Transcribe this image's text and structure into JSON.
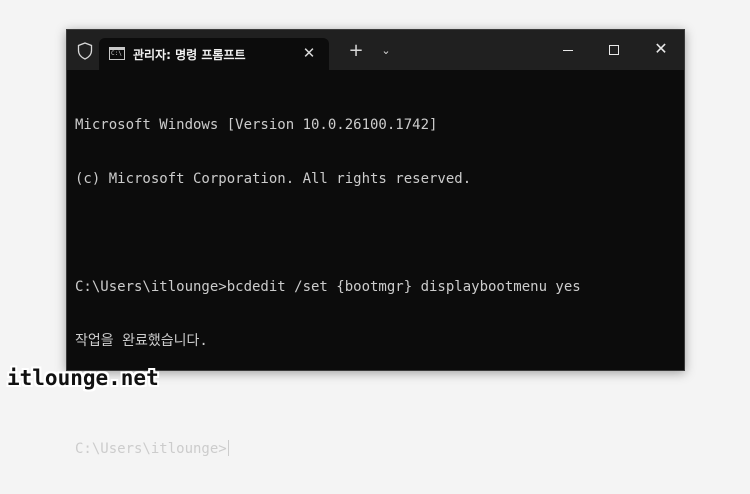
{
  "window": {
    "tab_title": "관리자: 명령 프롬프트",
    "tab_icon_text": "C:\\",
    "tab_close_glyph": "✕",
    "new_tab_glyph": "+",
    "dropdown_glyph": "⌄",
    "close_glyph": "✕"
  },
  "terminal": {
    "lines": [
      "Microsoft Windows [Version 10.0.26100.1742]",
      "(c) Microsoft Corporation. All rights reserved.",
      "",
      "C:\\Users\\itlounge>bcdedit /set {bootmgr} displaybootmenu yes",
      "작업을 완료했습니다.",
      ""
    ],
    "prompt": "C:\\Users\\itlounge>"
  },
  "watermark": "itlounge.net"
}
